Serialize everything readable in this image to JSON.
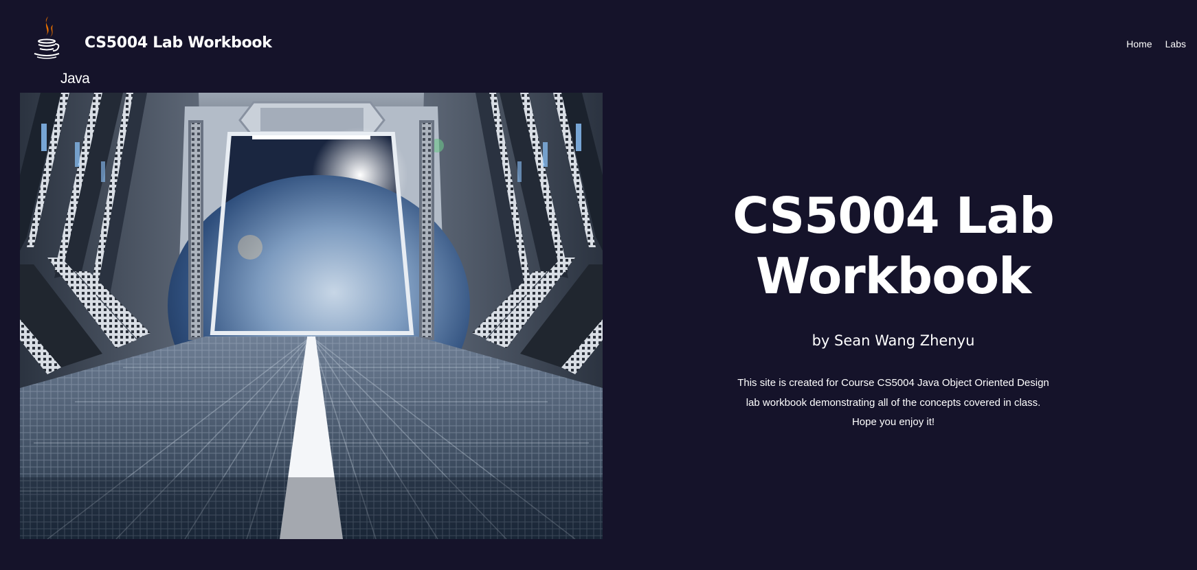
{
  "header": {
    "logo": {
      "icon": "java-coffee-cup-icon",
      "word": "Java",
      "steam_color": "#e76f00"
    },
    "site_title": "CS5004 Lab Workbook",
    "nav": [
      {
        "label": "Home"
      },
      {
        "label": "Labs"
      }
    ]
  },
  "hero": {
    "image": "spaceship-corridor-earth-image",
    "title_line1": "CS5004 Lab",
    "title_line2": "Workbook",
    "author": "by Sean Wang Zhenyu",
    "description": [
      "This site is created for Course CS5004 Java Object Oriented Design",
      "lab workbook demonstrating all of the concepts covered in class.",
      "Hope you enjoy it!"
    ]
  },
  "colors": {
    "background": "#15132a",
    "text": "#ffffff"
  }
}
